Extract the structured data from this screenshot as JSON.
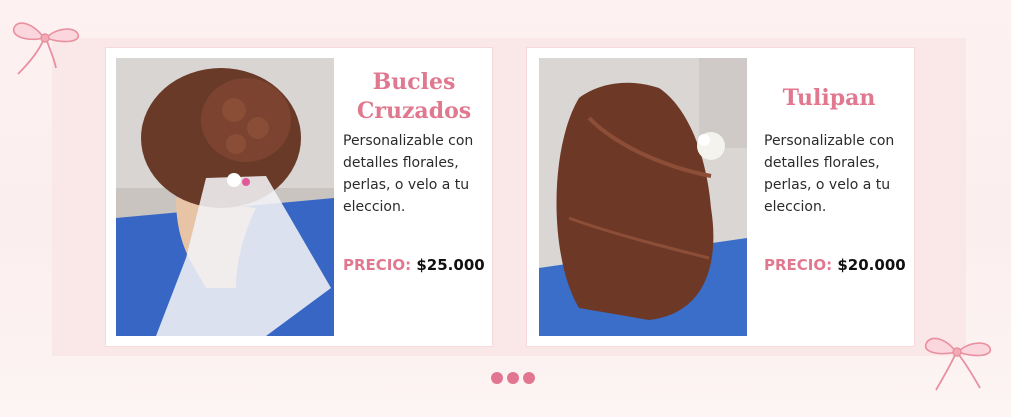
{
  "products": [
    {
      "title": "Bucles Cruzados",
      "description": "Personalizable con detalles florales, perlas, o velo a tu eleccion.",
      "price_label": "PRECIO:",
      "price_value": "$25.000"
    },
    {
      "title": "Tulipan",
      "description": "Personalizable con detalles florales, perlas, o velo a tu eleccion.",
      "price_label": "PRECIO:",
      "price_value": "$20.000"
    }
  ],
  "carousel": {
    "page_count": 3
  },
  "colors": {
    "accent": "#e0788f",
    "panel": "#f9e6e6",
    "dot": "#e27690"
  },
  "icons": [
    "ribbon-bow-icon"
  ]
}
